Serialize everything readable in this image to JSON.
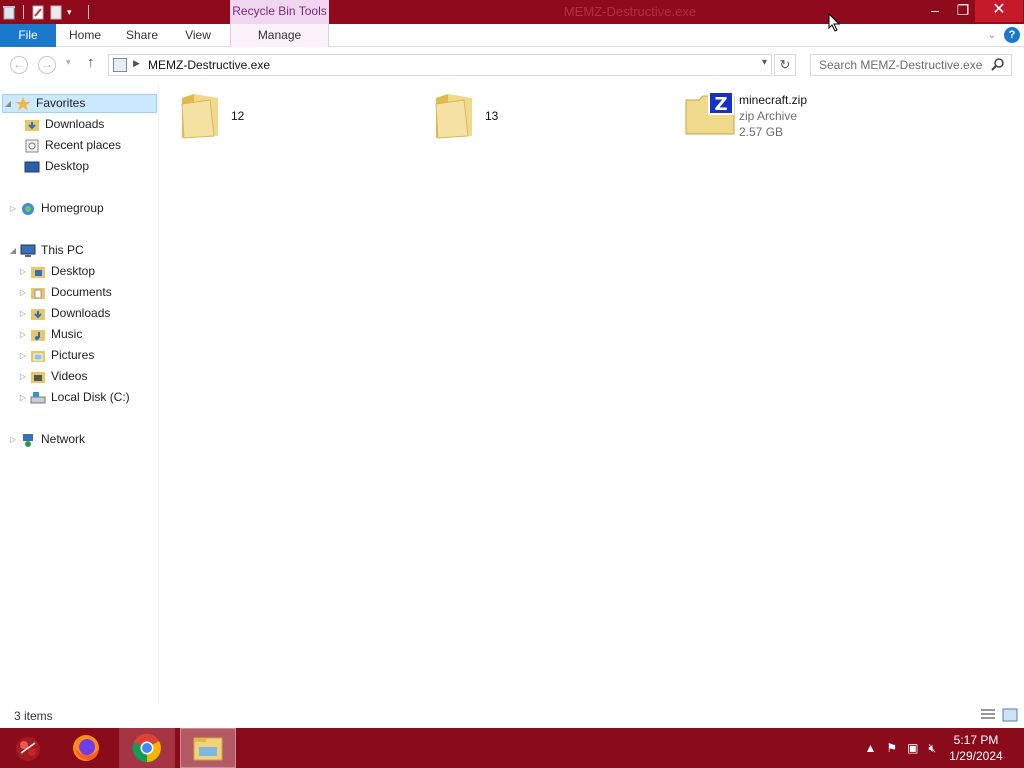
{
  "window": {
    "title": "MEMZ-Destructive.exe",
    "context_tab_group": "Recycle Bin Tools",
    "controls": {
      "minimize": "–",
      "maximize": "❐",
      "close": "✕"
    }
  },
  "ribbon": {
    "tabs": [
      "File",
      "Home",
      "Share",
      "View",
      "Manage"
    ]
  },
  "address": {
    "path": "MEMZ-Destructive.exe",
    "search_placeholder": "Search MEMZ-Destructive.exe"
  },
  "nav": {
    "favorites": {
      "label": "Favorites",
      "items": [
        "Downloads",
        "Recent places",
        "Desktop"
      ]
    },
    "homegroup": "Homegroup",
    "this_pc": {
      "label": "This PC",
      "items": [
        "Desktop",
        "Documents",
        "Downloads",
        "Music",
        "Pictures",
        "Videos",
        "Local Disk (C:)"
      ]
    },
    "network": "Network"
  },
  "content": {
    "items": [
      {
        "name": "12",
        "type": "folder"
      },
      {
        "name": "13",
        "type": "folder"
      },
      {
        "name": "minecraft.zip",
        "type_label": "zip Archive",
        "size": "2.57 GB"
      }
    ]
  },
  "status": {
    "item_count": "3 items"
  },
  "taskbar": {
    "time": "5:17 PM",
    "date": "1/29/2024",
    "apps": [
      "start-orb",
      "firefox",
      "chrome",
      "file-explorer"
    ]
  },
  "colors": {
    "titlebar": "#8f0b1c",
    "taskbar": "#8a0b19",
    "accent": "#1979ca",
    "selection": "#cce8ff"
  }
}
